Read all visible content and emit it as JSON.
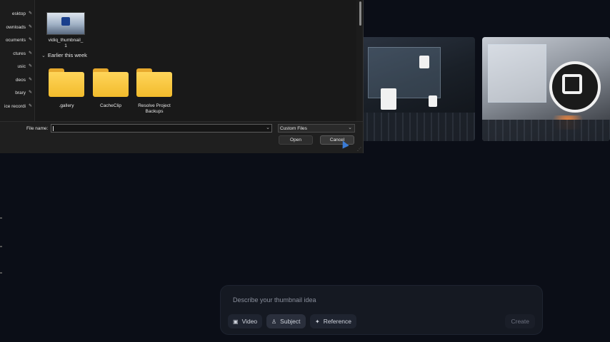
{
  "dialog": {
    "nav_items": [
      {
        "label": "esktop",
        "pinned": true
      },
      {
        "label": "ownloads",
        "pinned": true
      },
      {
        "label": "ocuments",
        "pinned": true
      },
      {
        "label": "ctures",
        "pinned": true
      },
      {
        "label": "usic",
        "pinned": true
      },
      {
        "label": "deos",
        "pinned": true
      },
      {
        "label": "brary",
        "pinned": true
      },
      {
        "label": "ice recordi",
        "pinned": true
      }
    ],
    "recent_file": {
      "name": "vidiq_thumbnail_1",
      "name_line1": "vidiq_thumbnail_",
      "name_line2": "1"
    },
    "group_header": "Earlier this week",
    "folders": [
      ".gallery",
      "CacheClip",
      "Resolve Project Backups"
    ],
    "folder_lines": [
      [
        ".gallery"
      ],
      [
        "CacheClip"
      ],
      [
        "Resolve Project",
        "Backups"
      ]
    ],
    "file_name_label": "File name:",
    "file_name_value": "",
    "file_type": "Custom Files",
    "open_label": "Open",
    "cancel_label": "Cancel"
  },
  "prompt": {
    "placeholder": "Describe your thumbnail idea",
    "chips": [
      {
        "label": "Video",
        "icon": "film-icon",
        "active": false
      },
      {
        "label": "Subject",
        "icon": "person-icon",
        "active": true
      },
      {
        "label": "Reference",
        "icon": "sparkle-icon",
        "active": false
      }
    ],
    "create_label": "Create"
  },
  "colors": {
    "background": "#0b0e17",
    "dialog": "#1c1c1c",
    "folder": "#f2bb2c",
    "accent_cursor": "#3a7bd5"
  }
}
